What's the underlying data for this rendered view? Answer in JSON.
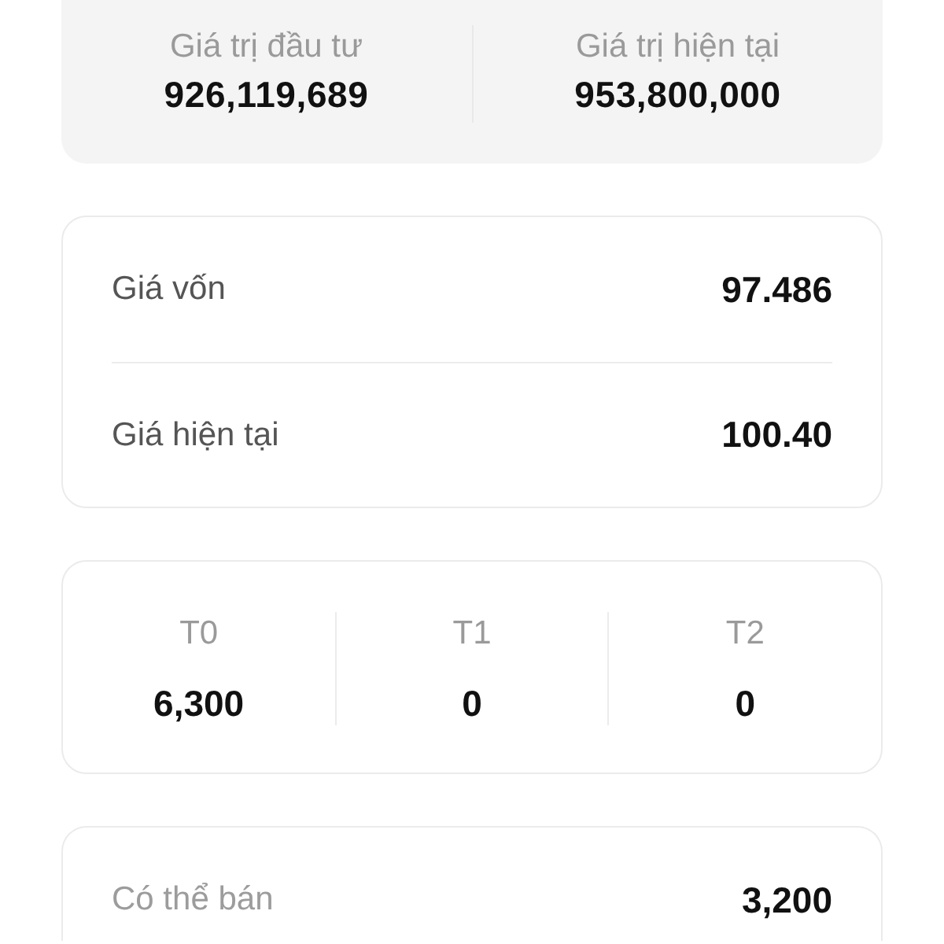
{
  "summary": {
    "items": [
      {
        "label": "Giá trị đầu tư",
        "value": "926,119,689"
      },
      {
        "label": "Giá trị hiện tại",
        "value": "953,800,000"
      }
    ]
  },
  "price_card": {
    "rows": [
      {
        "label": "Giá vốn",
        "value": "97.486",
        "muted": false
      },
      {
        "label": "Giá hiện tại",
        "value": "100.40",
        "muted": false
      }
    ]
  },
  "settlement": {
    "columns": [
      {
        "label": "T0",
        "value": "6,300"
      },
      {
        "label": "T1",
        "value": "0"
      },
      {
        "label": "T2",
        "value": "0"
      }
    ]
  },
  "sellable_card": {
    "rows": [
      {
        "label": "Có thể bán",
        "value": "3,200",
        "muted": true
      }
    ]
  }
}
